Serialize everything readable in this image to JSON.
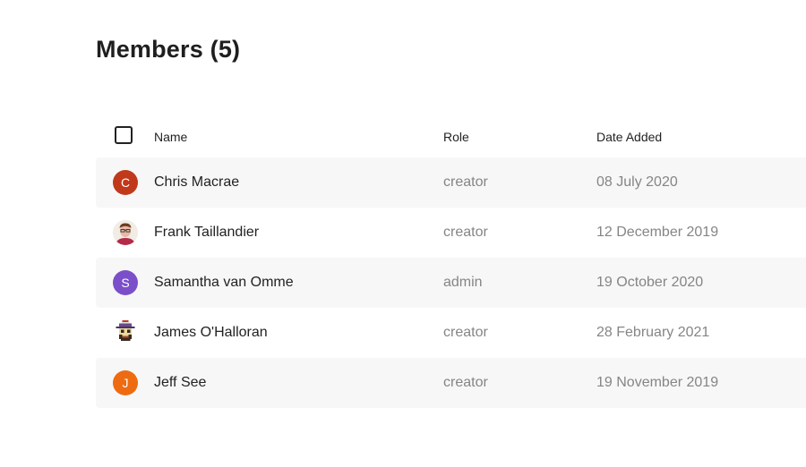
{
  "page": {
    "title": "Members (5)"
  },
  "table": {
    "headers": {
      "name": "Name",
      "role": "Role",
      "date_added": "Date Added"
    },
    "rows": [
      {
        "avatar_type": "initial",
        "initial": "C",
        "avatar_color": "#c0391b",
        "name": "Chris Macrae",
        "role": "creator",
        "date_added": "08 July 2020"
      },
      {
        "avatar_type": "photo",
        "avatar_icon": "person-photo-icon",
        "name": "Frank Taillandier",
        "role": "creator",
        "date_added": "12 December 2019"
      },
      {
        "avatar_type": "initial",
        "initial": "S",
        "avatar_color": "#7b4fc9",
        "name": "Samantha van Omme",
        "role": "admin",
        "date_added": "19 October 2020"
      },
      {
        "avatar_type": "photo",
        "avatar_icon": "pixel-character-icon",
        "name": "James O'Halloran",
        "role": "creator",
        "date_added": "28 February 2021"
      },
      {
        "avatar_type": "initial",
        "initial": "J",
        "avatar_color": "#ee6b12",
        "name": "Jeff See",
        "role": "creator",
        "date_added": "19 November 2019"
      }
    ]
  }
}
